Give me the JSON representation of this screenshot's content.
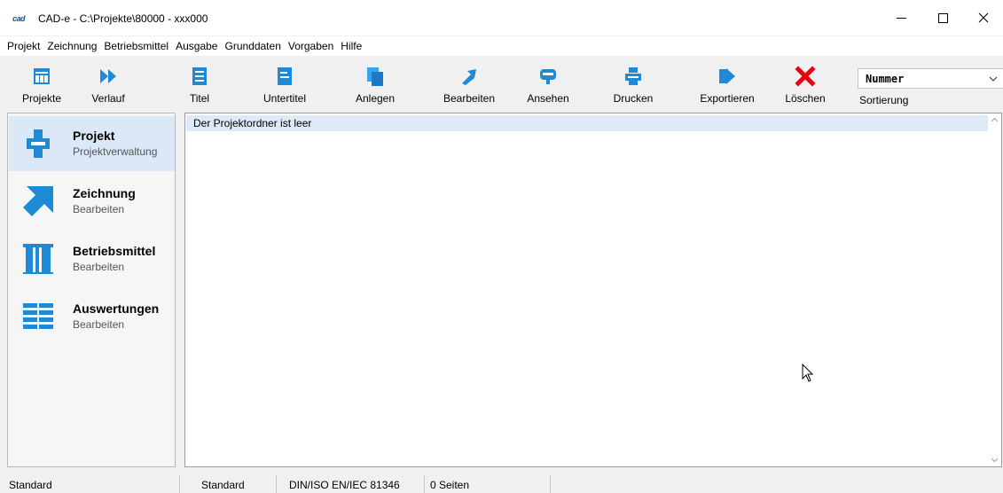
{
  "window": {
    "logo_text": "cad",
    "title": "CAD-e - C:\\Projekte\\80000 - xxx000"
  },
  "menu": [
    "Projekt",
    "Zeichnung",
    "Betriebsmittel",
    "Ausgabe",
    "Grunddaten",
    "Vorgaben",
    "Hilfe"
  ],
  "toolbar": {
    "buttons": [
      {
        "label": "Projekte",
        "icon": "projects-icon"
      },
      {
        "label": "Verlauf",
        "icon": "history-forward-icon"
      },
      {
        "label": "Titel",
        "icon": "title-icon"
      },
      {
        "label": "Untertitel",
        "icon": "subtitle-icon"
      },
      {
        "label": "Anlegen",
        "icon": "create-icon"
      },
      {
        "label": "Bearbeiten",
        "icon": "edit-arrow-icon"
      },
      {
        "label": "Ansehen",
        "icon": "view-icon"
      },
      {
        "label": "Drucken",
        "icon": "print-icon"
      },
      {
        "label": "Exportieren",
        "icon": "export-icon"
      },
      {
        "label": "Löschen",
        "icon": "delete-x-icon"
      }
    ],
    "sort": {
      "value": "Nummer",
      "label": "Sortierung"
    }
  },
  "sidebar": {
    "items": [
      {
        "title": "Projekt",
        "subtitle": "Projektverwaltung",
        "icon": "project-icon",
        "active": true
      },
      {
        "title": "Zeichnung",
        "subtitle": "Bearbeiten",
        "icon": "drawing-arrow-icon",
        "active": false
      },
      {
        "title": "Betriebsmittel",
        "subtitle": "Bearbeiten",
        "icon": "equipment-icon",
        "active": false
      },
      {
        "title": "Auswertungen",
        "subtitle": "Bearbeiten",
        "icon": "reports-icon",
        "active": false
      }
    ]
  },
  "content": {
    "message": "Der Projektordner ist leer"
  },
  "statusbar": {
    "cells": [
      "Standard",
      "Standard",
      "DIN/ISO EN/IEC 81346",
      "0 Seiten"
    ]
  },
  "colors": {
    "accent_blue": "#1e8ad6",
    "delete_red": "#e8000d",
    "active_row": "#dbe8f7"
  }
}
